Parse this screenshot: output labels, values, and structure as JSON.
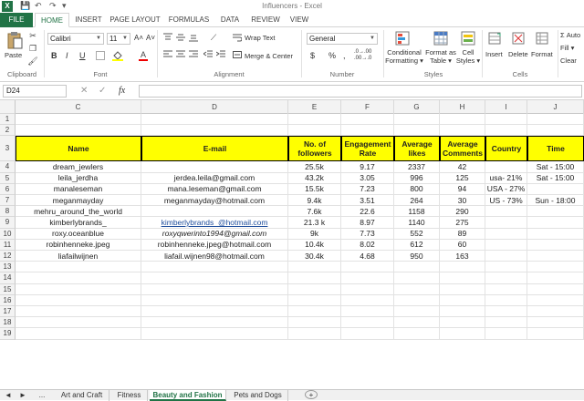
{
  "window": {
    "title": "Influencers - Excel",
    "app_icon": "X"
  },
  "qat": {
    "save": "💾",
    "undo": "↶",
    "redo": "↷",
    "more": "▾"
  },
  "ribbon_tabs": [
    "FILE",
    "HOME",
    "INSERT",
    "PAGE LAYOUT",
    "FORMULAS",
    "DATA",
    "REVIEW",
    "VIEW"
  ],
  "ribbon": {
    "paste": "Paste",
    "font_name": "Calibri",
    "font_size": "11",
    "bold": "B",
    "italic": "I",
    "underline": "U",
    "increase_font": "A˄",
    "decrease_font": "A˅",
    "wrap_text": "Wrap Text",
    "merge_center": "Merge & Center",
    "number_format": "General",
    "currency": "$",
    "percent": "%",
    "comma": ",",
    "inc_dec": ".0→.00",
    "dec_dec": ".00→.0",
    "conditional_formatting": [
      "Conditional",
      "Formatting ▾"
    ],
    "format_as_table": [
      "Format as",
      "Table ▾"
    ],
    "cell_styles": [
      "Cell",
      "Styles ▾"
    ],
    "insert": "Insert",
    "delete": "Delete",
    "format": "Format",
    "autosum": "Σ Auto",
    "fill": "Fill ▾",
    "clear": "Clear",
    "groups": {
      "clipboard": "Clipboard",
      "font": "Font",
      "alignment": "Alignment",
      "number": "Number",
      "styles": "Styles",
      "cells": "Cells"
    }
  },
  "formula_bar": {
    "name_box": "D24",
    "fx": "fx",
    "cancel": "✕",
    "enter": "✓",
    "value": ""
  },
  "columns": [
    "C",
    "D",
    "E",
    "F",
    "G",
    "H",
    "I",
    "J"
  ],
  "rows": [
    "1",
    "2",
    "3",
    "4",
    "5",
    "6",
    "7",
    "8",
    "9",
    "10",
    "11",
    "12",
    "13",
    "14",
    "15",
    "16",
    "17",
    "18",
    "19"
  ],
  "table": {
    "headers": [
      "Name",
      "E-mail",
      "No. of followers",
      "Engagement Rate",
      "Average likes",
      "Average Comments",
      "Country",
      "Time"
    ],
    "rows": [
      [
        "dream_jewlers",
        "",
        "25.5k",
        "9.17",
        "2337",
        "42",
        "",
        "Sat - 15:00"
      ],
      [
        "leila_jerdha",
        "jerdea.leila@gmail.com",
        "43.2k",
        "3.05",
        "996",
        "125",
        "usa- 21%",
        "Sat - 15:00"
      ],
      [
        "manaleseman",
        "mana.leseman@gmail.com",
        "15.5k",
        "7.23",
        "800",
        "94",
        "USA - 27%",
        ""
      ],
      [
        "meganmayday",
        "meganmayday@hotmail.com",
        "9.4k",
        "3.51",
        "264",
        "30",
        "US - 73%",
        "Sun - 18:00"
      ],
      [
        "mehru_around_the_world",
        "",
        "7.6k",
        "22.6",
        "1158",
        "290",
        "",
        ""
      ],
      [
        "kimberlybrands_",
        "kimberlybrands_@hotmail.com",
        "21.3 k",
        "8.97",
        "1140",
        "275",
        "",
        ""
      ],
      [
        "roxy.oceanblue",
        "roxyqwerinto1994@gmail.com",
        "9k",
        "7.73",
        "552",
        "89",
        "",
        ""
      ],
      [
        "robinhenneke.jpeg",
        "robinhenneke.jpeg@hotmail.com",
        "10.4k",
        "8.02",
        "612",
        "60",
        "",
        ""
      ],
      [
        "liafailwijnen",
        "liafail.wijnen98@hotmail.com",
        "30.4k",
        "4.68",
        "950",
        "163",
        "",
        ""
      ]
    ]
  },
  "sheets": {
    "nav_prev": "◄",
    "nav_next": "►",
    "more": "...",
    "tabs": [
      "Art and Craft",
      "Fitness",
      "Beauty and Fashion",
      "Pets and Dogs"
    ],
    "active": "Beauty and Fashion",
    "add": "+"
  },
  "colors": {
    "excel_green": "#217346",
    "header_fill": "#ffff00"
  }
}
